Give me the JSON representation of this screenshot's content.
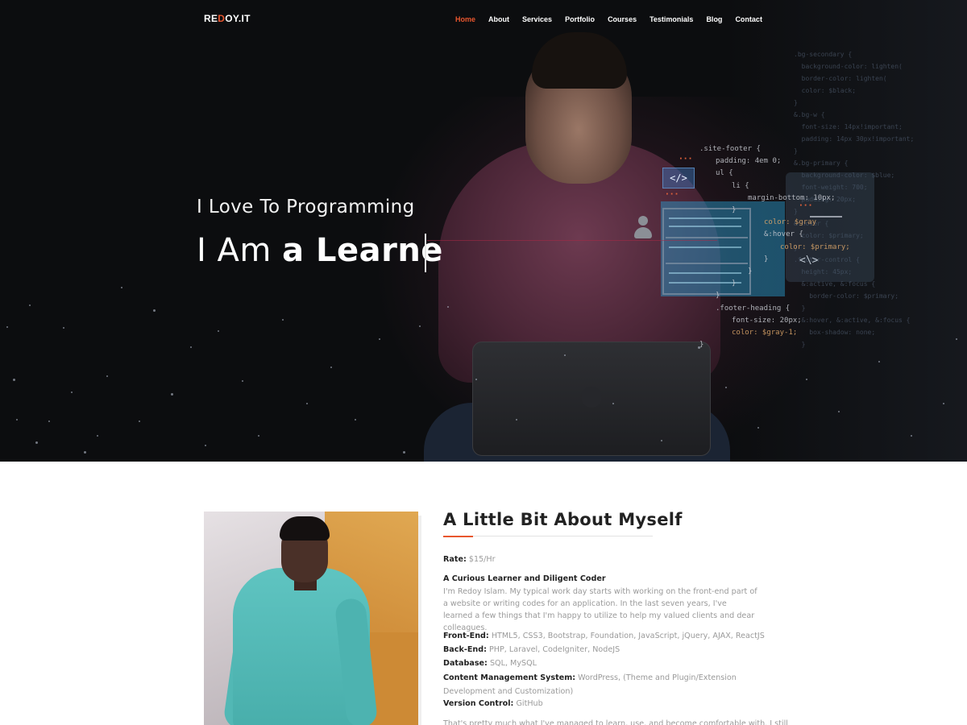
{
  "nav": {
    "logo_main_1": "RE",
    "logo_accent": "D",
    "logo_main_2": "OY.IT",
    "items": [
      {
        "label": "Home",
        "active": true
      },
      {
        "label": "About"
      },
      {
        "label": "Services"
      },
      {
        "label": "Portfolio"
      },
      {
        "label": "Courses"
      },
      {
        "label": "Testimonials"
      },
      {
        "label": "Blog"
      },
      {
        "label": "Contact"
      }
    ]
  },
  "hero": {
    "subtitle": "I Love To Programming",
    "title_light": "I Am ",
    "title_bold": "a Learne",
    "code_lines": [
      ".site-footer {",
      "    padding: 4em 0;",
      "    ul {",
      "        li {",
      "            margin-bottom: 10px;",
      "        }",
      "            color: $gray",
      "            &:hover {",
      "                color: $primary;",
      "            }",
      "        }",
      "    }",
      "}",
      ".footer-heading {",
      "    font-size: 20px;",
      "    color: $gray-1;",
      "}"
    ],
    "code_tag": "</>",
    "code_symbol": "<\\>"
  },
  "about": {
    "title": "A Little Bit About Myself",
    "rate_label": "Rate:",
    "rate_value": "$15/Hr",
    "heading": "A Curious Learner and Diligent Coder",
    "intro": "I'm Redoy Islam. My typical work day starts with working on the front-end part of a website or writing codes for an application. In the last seven years, I've learned a few things that I'm happy to utilize to help my valued clients and dear colleagues.",
    "skills": [
      {
        "label": "Front-End:",
        "value": "HTML5, CSS3, Bootstrap, Foundation, JavaScript, jQuery, AJAX, ReactJS"
      },
      {
        "label": "Back-End:",
        "value": "PHP, Laravel, CodeIgniter, NodeJS"
      },
      {
        "label": "Database:",
        "value": "SQL, MySQL"
      },
      {
        "label": "Content Management System:",
        "value": "WordPress, (Theme and Plugin/Extension Development and Customization)"
      },
      {
        "label": "Version Control:",
        "value": "GitHub"
      }
    ],
    "outro": "That's pretty much what I've managed to learn, use, and become comfortable with. I still"
  },
  "colors": {
    "accent": "#e8562e",
    "hero_bg": "#0c0d0f",
    "heading": "#222222",
    "body_text": "#9a9a9a"
  }
}
